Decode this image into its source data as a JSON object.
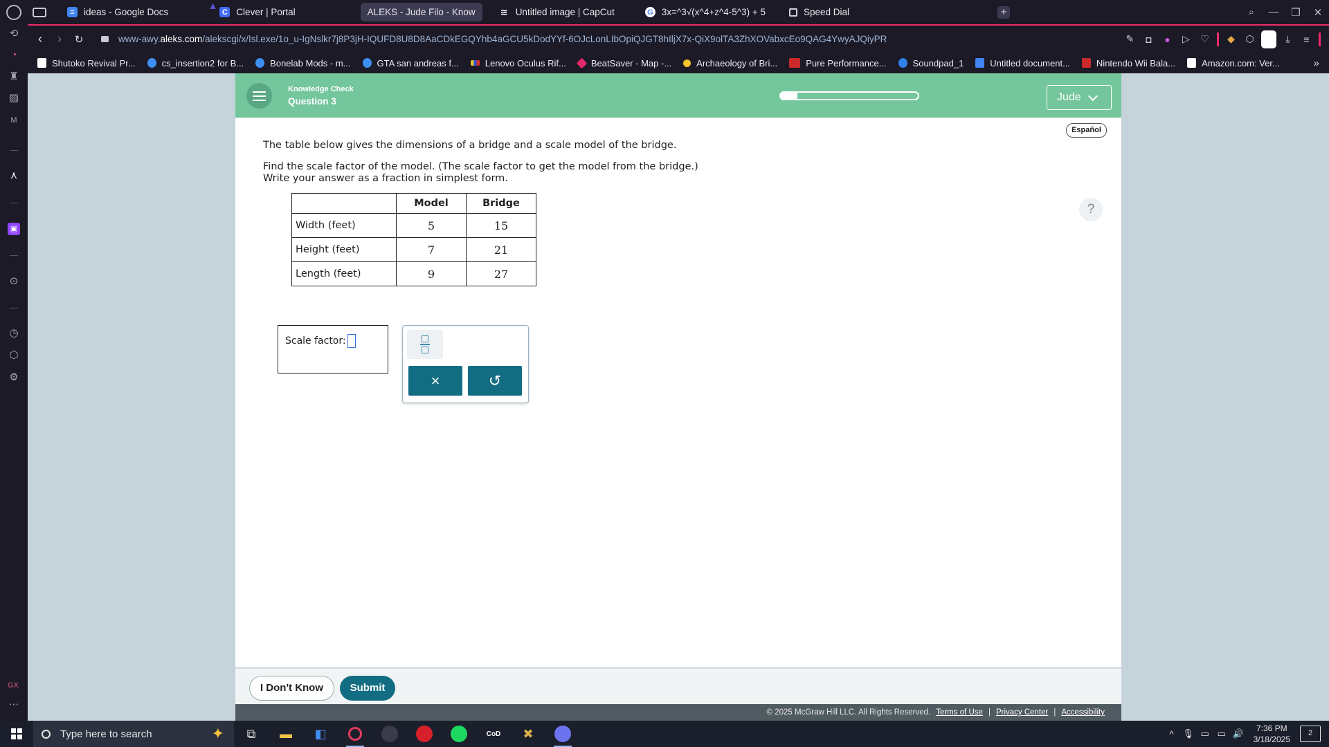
{
  "browser": {
    "tabs": [
      {
        "label": "ideas - Google Docs",
        "icon": "google-docs-icon",
        "active": false
      },
      {
        "label": "Clever | Portal",
        "icon": "clever-icon",
        "active": false
      },
      {
        "label": "ALEKS - Jude Filo - Know",
        "icon": "aleks-icon",
        "active": true
      },
      {
        "label": "Untitled image | CapCut",
        "icon": "capcut-icon",
        "active": false
      },
      {
        "label": "3x=^3√(x^4+z^4-5^3) + 5",
        "icon": "google-icon",
        "active": false
      },
      {
        "label": "Speed Dial",
        "icon": "speed-dial-icon",
        "active": false
      }
    ],
    "url_prefix": "www-awy.",
    "url_host": "aleks.com",
    "url_path": "/alekscgi/x/Isl.exe/1o_u-IgNslkr7j8P3jH-IQUFD8U8D8AaCDkEGQYhb4aGCU5kDodYYf-6OJcLonLIbOpiQJGT8hIljX7x-QiX9olTA3ZhXOVabxcEo9QAG4YwyAJQiyPR",
    "bookmarks": [
      {
        "label": "Shutoko Revival Pr...",
        "color": "#ffffff"
      },
      {
        "label": "cs_insertion2 for B...",
        "color": "#3d8ef0"
      },
      {
        "label": "Bonelab Mods - m...",
        "color": "#3d8ef0"
      },
      {
        "label": "GTA san andreas f...",
        "color": "#3d8ef0"
      },
      {
        "label": "Lenovo Oculus Rif...",
        "color": "#e2c22a"
      },
      {
        "label": "BeatSaver - Map -...",
        "color": "#e52a6b"
      },
      {
        "label": "Archaeology of Bri...",
        "color": "#f2c230"
      },
      {
        "label": "Pure Performance...",
        "color": "#cc2a2a"
      },
      {
        "label": "Soundpad_1",
        "color": "#2f80e8"
      },
      {
        "label": "Untitled document...",
        "color": "#4285f4"
      },
      {
        "label": "Nintendo Wii Bala...",
        "color": "#cc2a2a"
      },
      {
        "label": "Amazon.com: Ver...",
        "color": "#ffffff"
      }
    ]
  },
  "aleks": {
    "header_title": "Knowledge Check",
    "header_sub": "Question 3",
    "progress": 0.12,
    "user": "Jude",
    "espanol": "Español",
    "help": "?",
    "q_line1": "The table below gives the dimensions of a bridge and a scale model of the bridge.",
    "q_line2": "Find the scale factor of the model. (The scale factor to get the model from the bridge.)",
    "q_line3": "Write your answer as a fraction in simplest form.",
    "table": {
      "headers": [
        "",
        "Model",
        "Bridge"
      ],
      "rows": [
        {
          "label": "Width (feet)",
          "model": "5",
          "bridge": "15"
        },
        {
          "label": "Height (feet)",
          "model": "7",
          "bridge": "21"
        },
        {
          "label": "Length (feet)",
          "model": "9",
          "bridge": "27"
        }
      ]
    },
    "answer_label": "Scale factor:",
    "palette_clear": "×",
    "palette_undo": "↺",
    "btn_dont_know": "I Don't Know",
    "btn_submit": "Submit",
    "copyright": "© 2025 McGraw Hill LLC. All Rights Reserved.",
    "terms": "Terms of Use",
    "privacy": "Privacy Center",
    "accessibility": "Accessibility",
    "accent": "#74c69d",
    "primary": "#136d82"
  },
  "taskbar": {
    "search_placeholder": "Type here to search",
    "time": "7:36 PM",
    "date": "3/18/2025",
    "notifications": "2"
  }
}
